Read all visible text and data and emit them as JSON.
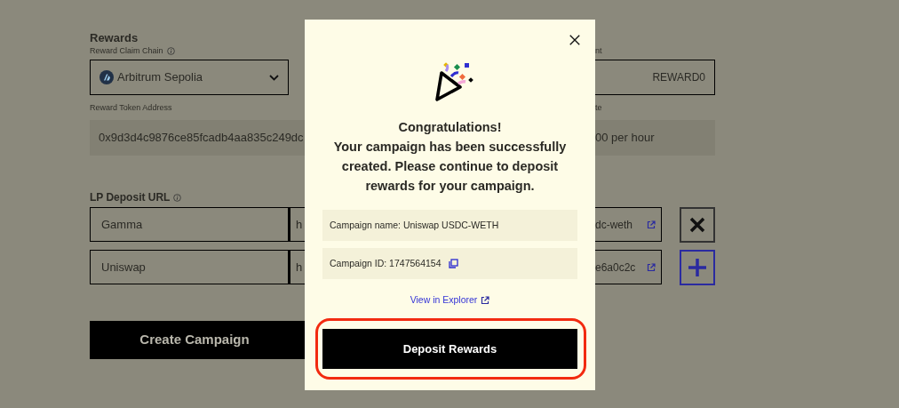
{
  "form": {
    "heading": "Rewards",
    "claim_chain": {
      "label": "Reward Claim Chain",
      "value": "Arbitrum Sepolia"
    },
    "column_3": {
      "label": "nt",
      "value": "REWARD0"
    },
    "token_address": {
      "label": "Reward Token Address",
      "value": "0x9d3d4c9876ce85fcadb4aa835c249dc"
    },
    "column_4": {
      "label": "te",
      "value": "00 per hour"
    },
    "lp_deposit": {
      "label": "LP Deposit URL",
      "rows": [
        {
          "name": "Gamma",
          "url_start": "h",
          "url_end": "dc-weth",
          "kind": "remove"
        },
        {
          "name": "Uniswap",
          "url_start": "h",
          "url_end": "e6a0c2c",
          "kind": "add"
        }
      ]
    },
    "submit": "Create Campaign"
  },
  "modal": {
    "title": "Congratulations!",
    "message": "Your campaign has been successfully created. Please continue to deposit rewards for your campaign.",
    "details": [
      {
        "text": "Campaign name:  Uniswap USDC-WETH",
        "copy": false
      },
      {
        "text": "Campaign ID: 1747564154",
        "copy": true
      }
    ],
    "link": "View in Explorer",
    "button": "Deposit Rewards"
  }
}
